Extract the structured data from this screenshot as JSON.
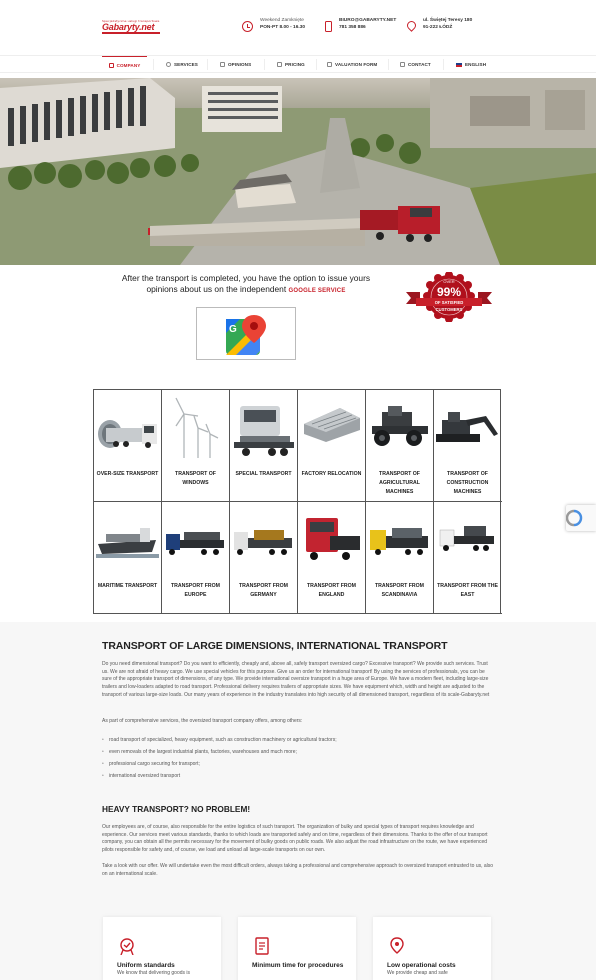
{
  "header": {
    "logo": {
      "tagline": "Specjalistyczne usługi transportowe",
      "name": "Gabaryty.net"
    },
    "hours": {
      "line1": "Weekend Zamknięte",
      "line2": "PON-PT 8.00 - 16.30"
    },
    "contact": {
      "line1": "BIURO@GABARYTY.NET",
      "line2": "781 358 886"
    },
    "address": {
      "line1": "ul. Świętej Teresy 180",
      "line2": "91-222 ŁÓDŹ"
    }
  },
  "nav": [
    {
      "label": "COMPANY",
      "active": true
    },
    {
      "label": "SERVICES"
    },
    {
      "label": "OPINIONS"
    },
    {
      "label": "PRICING"
    },
    {
      "label": "VALUATION FORM"
    },
    {
      "label": "CONTACT"
    },
    {
      "label": "ENGLISH"
    }
  ],
  "opinions": {
    "text": "After the transport is completed, you have the option to issue yours opinions about us on the independent",
    "link": "GOOGLE SERVICE",
    "badge": {
      "top": "OVER",
      "value": "99%",
      "line1": "OF SATISFIED",
      "line2": "CUSTOMERS"
    }
  },
  "services": [
    "OVER-SIZE TRANSPORT",
    "TRANSPORT OF WINDOWS",
    "SPECIAL TRANSPORT",
    "FACTORY RELOCATION",
    "TRANSPORT OF AGRICULTURAL MACHINES",
    "TRANSPORT OF CONSTRUCTION MACHINES",
    "MARITIME TRANSPORT",
    "TRANSPORT FROM EUROPE",
    "TRANSPORT FROM GERMANY",
    "TRANSPORT FROM ENGLAND",
    "TRANSPORT FROM SCANDINAVIA",
    "TRANSPORT FROM THE EAST"
  ],
  "article": {
    "title": "TRANSPORT OF LARGE DIMENSIONS, INTERNATIONAL TRANSPORT",
    "p1": "Do you need dimensional transport? Do you want to efficiently, cheaply and, above all, safely transport oversized cargo? Excessive transport? We provide such services. Trust us. We are not afraid of heavy cargo. We use special vehicles for this purpose. Give us an order for international transport! By using the services of professionals, you can be sure of the appropriate transport of dimensions, of any type. We provide international oversize transport in a huge area of Europe. We have a modern fleet, including large-size trailers and low-loaders adapted to road transport. Professional delivery requires trailers of appropriate sizes. We have equipment which, width and height are adjusted to the transport of various large-size loads. Our many years of experience in the industry translates into high security of all dimensioned transport, regardless of its scale-Gabaryty.net",
    "p2": "As part of comprehensive services, the oversized transport company offers, among others:",
    "bullets": [
      "road transport of specialized, heavy equipment, such as construction machinery or agricultural tractors;",
      "even removals of the largest industrial plants, factories, warehouses and much more;",
      "professional cargo securing for transport;",
      "international oversized transport"
    ],
    "h2": "HEAVY TRANSPORT? NO PROBLEM!",
    "p3": "Our employees are, of course, also responsible for the entire logistics of such transport. The organization of bulky and special types of transport requires knowledge and experience. Our services meet various standards, thanks to which loads are transported safely and on time, regardless of their dimensions. Thanks to the offer of our transport company, you can obtain all the permits necessary for the movement of bulky goods on public roads. We also adjust the road infrastructure on the route, we have experienced pilots responsible for safety and, of course, we load and unload all large-scale transports on our own.",
    "p4": "Take a look with our offer. We will undertake even the most difficult orders, always taking a professional and comprehensive approach to oversized transport entrusted to us, also on an international scale."
  },
  "cards": [
    {
      "title": "Uniform standards",
      "desc": "We know that delivering goods is"
    },
    {
      "title": "Minimum time for procedures",
      "desc": ""
    },
    {
      "title": "Low operational costs",
      "desc": "We provide cheap and safe"
    }
  ]
}
